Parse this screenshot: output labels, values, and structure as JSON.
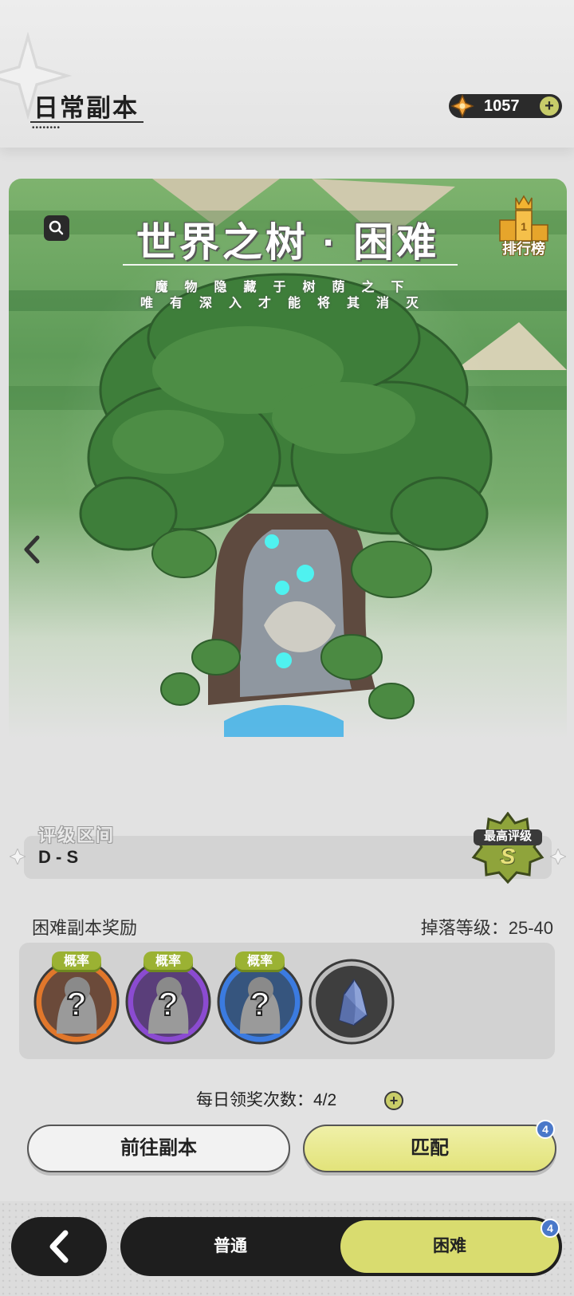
{
  "header": {
    "title": "日常副本",
    "currency": {
      "value": "1057",
      "icon": "crystal-star-icon",
      "plus": "+"
    }
  },
  "banner": {
    "dungeon_name": "世界之树 · 困难",
    "subtitle_line1": "魔物隐藏于树荫之下",
    "subtitle_line2": "唯有深入才能将其消灭",
    "leaderboard_label": "排行榜",
    "search_icon": "search-icon",
    "prev_icon": "chevron-left-icon"
  },
  "grade": {
    "label": "评级区间",
    "value": "D - S",
    "best_label": "最高评级",
    "best_value": "S"
  },
  "rewards": {
    "title": "困难副本奖励",
    "drop_level": "掉落等级：25-40",
    "items": [
      {
        "tag": "概率",
        "icon": "unknown-character-icon",
        "frame": "#e1772b"
      },
      {
        "tag": "概率",
        "icon": "unknown-character-icon",
        "frame": "#8b4bd1"
      },
      {
        "tag": "概率",
        "icon": "unknown-character-icon",
        "frame": "#3b7be0"
      },
      {
        "tag": "",
        "icon": "crystal-ore-icon",
        "frame": "#9a9a9a"
      }
    ]
  },
  "daily": {
    "label": "每日领奖次数：4/2",
    "plus": "+"
  },
  "actions": {
    "goto_label": "前往副本",
    "match_label": "匹配",
    "match_badge": "4"
  },
  "bottom_nav": {
    "back_icon": "back-arrow-icon",
    "tabs": [
      {
        "label": "普通",
        "active": false
      },
      {
        "label": "困难",
        "active": true,
        "badge": "4"
      }
    ]
  },
  "colors": {
    "accent": "#d9dc6f",
    "dark": "#1e1e1e",
    "badge": "#4a78c9"
  }
}
